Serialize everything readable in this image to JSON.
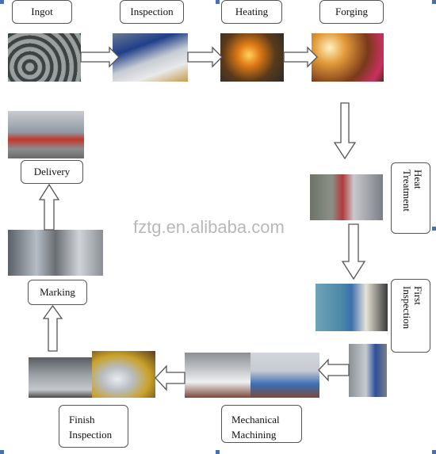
{
  "steps": {
    "ingot": "Ingot",
    "inspection": "Inspection",
    "heating": "Heating",
    "forging": "Forging",
    "heat_treatment_1": "Heat",
    "heat_treatment_2": "Treatment",
    "first_inspection_1": "First",
    "first_inspection_2": "Inspection",
    "mechanical_machining_1": "Mechanical",
    "mechanical_machining_2": "Machining",
    "finish_inspection_1": "Finish",
    "finish_inspection_2": "Inspection",
    "marking": "Marking",
    "delivery": "Delivery"
  },
  "watermark": "fztg.en.alibaba.com",
  "colors": {
    "border": "#555555",
    "handle": "#4a6fb0",
    "watermark": "#b8b8b8"
  }
}
